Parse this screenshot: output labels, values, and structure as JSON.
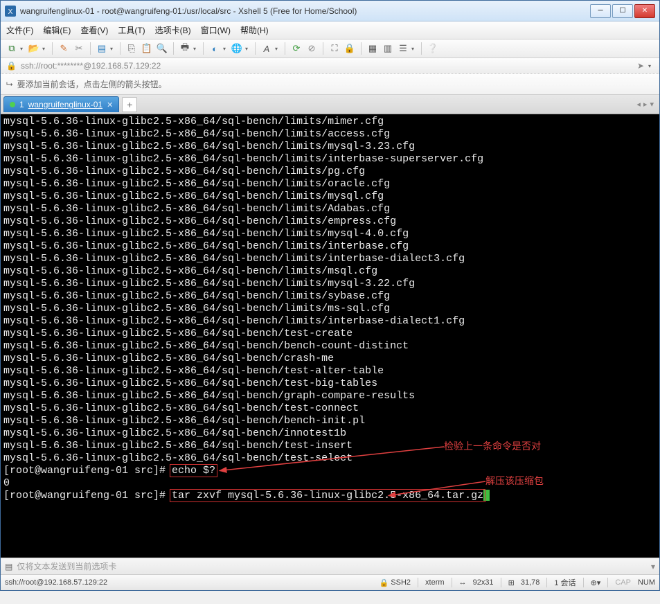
{
  "window": {
    "title": "wangruifenglinux-01 - root@wangruifeng-01:/usr/local/src - Xshell 5 (Free for Home/School)"
  },
  "menu": {
    "file": "文件(F)",
    "edit": "编辑(E)",
    "view": "查看(V)",
    "tools": "工具(T)",
    "tabs": "选项卡(B)",
    "window": "窗口(W)",
    "help": "帮助(H)"
  },
  "address": "ssh://root:********@192.168.57.129:22",
  "infobar": "要添加当前会话，点击左侧的箭头按钮。",
  "tab": {
    "index": "1",
    "name": "wangruifenglinux-01"
  },
  "terminal_lines": [
    "mysql-5.6.36-linux-glibc2.5-x86_64/sql-bench/limits/mimer.cfg",
    "mysql-5.6.36-linux-glibc2.5-x86_64/sql-bench/limits/access.cfg",
    "mysql-5.6.36-linux-glibc2.5-x86_64/sql-bench/limits/mysql-3.23.cfg",
    "mysql-5.6.36-linux-glibc2.5-x86_64/sql-bench/limits/interbase-superserver.cfg",
    "mysql-5.6.36-linux-glibc2.5-x86_64/sql-bench/limits/pg.cfg",
    "mysql-5.6.36-linux-glibc2.5-x86_64/sql-bench/limits/oracle.cfg",
    "mysql-5.6.36-linux-glibc2.5-x86_64/sql-bench/limits/mysql.cfg",
    "mysql-5.6.36-linux-glibc2.5-x86_64/sql-bench/limits/Adabas.cfg",
    "mysql-5.6.36-linux-glibc2.5-x86_64/sql-bench/limits/empress.cfg",
    "mysql-5.6.36-linux-glibc2.5-x86_64/sql-bench/limits/mysql-4.0.cfg",
    "mysql-5.6.36-linux-glibc2.5-x86_64/sql-bench/limits/interbase.cfg",
    "mysql-5.6.36-linux-glibc2.5-x86_64/sql-bench/limits/interbase-dialect3.cfg",
    "mysql-5.6.36-linux-glibc2.5-x86_64/sql-bench/limits/msql.cfg",
    "mysql-5.6.36-linux-glibc2.5-x86_64/sql-bench/limits/mysql-3.22.cfg",
    "mysql-5.6.36-linux-glibc2.5-x86_64/sql-bench/limits/sybase.cfg",
    "mysql-5.6.36-linux-glibc2.5-x86_64/sql-bench/limits/ms-sql.cfg",
    "mysql-5.6.36-linux-glibc2.5-x86_64/sql-bench/limits/interbase-dialect1.cfg",
    "mysql-5.6.36-linux-glibc2.5-x86_64/sql-bench/test-create",
    "mysql-5.6.36-linux-glibc2.5-x86_64/sql-bench/bench-count-distinct",
    "mysql-5.6.36-linux-glibc2.5-x86_64/sql-bench/crash-me",
    "mysql-5.6.36-linux-glibc2.5-x86_64/sql-bench/test-alter-table",
    "mysql-5.6.36-linux-glibc2.5-x86_64/sql-bench/test-big-tables",
    "mysql-5.6.36-linux-glibc2.5-x86_64/sql-bench/graph-compare-results",
    "mysql-5.6.36-linux-glibc2.5-x86_64/sql-bench/test-connect",
    "mysql-5.6.36-linux-glibc2.5-x86_64/sql-bench/bench-init.pl",
    "mysql-5.6.36-linux-glibc2.5-x86_64/sql-bench/innotest1b",
    "mysql-5.6.36-linux-glibc2.5-x86_64/sql-bench/test-insert",
    "mysql-5.6.36-linux-glibc2.5-x86_64/sql-bench/test-select"
  ],
  "prompt1": "[root@wangruifeng-01 src]# ",
  "cmd1": "echo $?",
  "result1": "0",
  "prompt2": "[root@wangruifeng-01 src]# ",
  "cmd2": "tar zxvf mysql-5.6.36-linux-glibc2.5-x86_64.tar.gz",
  "annotation1": "检验上一条命令是否对",
  "annotation2": "解压该压缩包",
  "sendbar": "仅将文本发送到当前选项卡",
  "status": {
    "left": "ssh://root@192.168.57.129:22",
    "ssh": "SSH2",
    "term": "xterm",
    "size": "92x31",
    "pos": "31,78",
    "sessions": "1 会话",
    "cap": "CAP",
    "num": "NUM"
  }
}
